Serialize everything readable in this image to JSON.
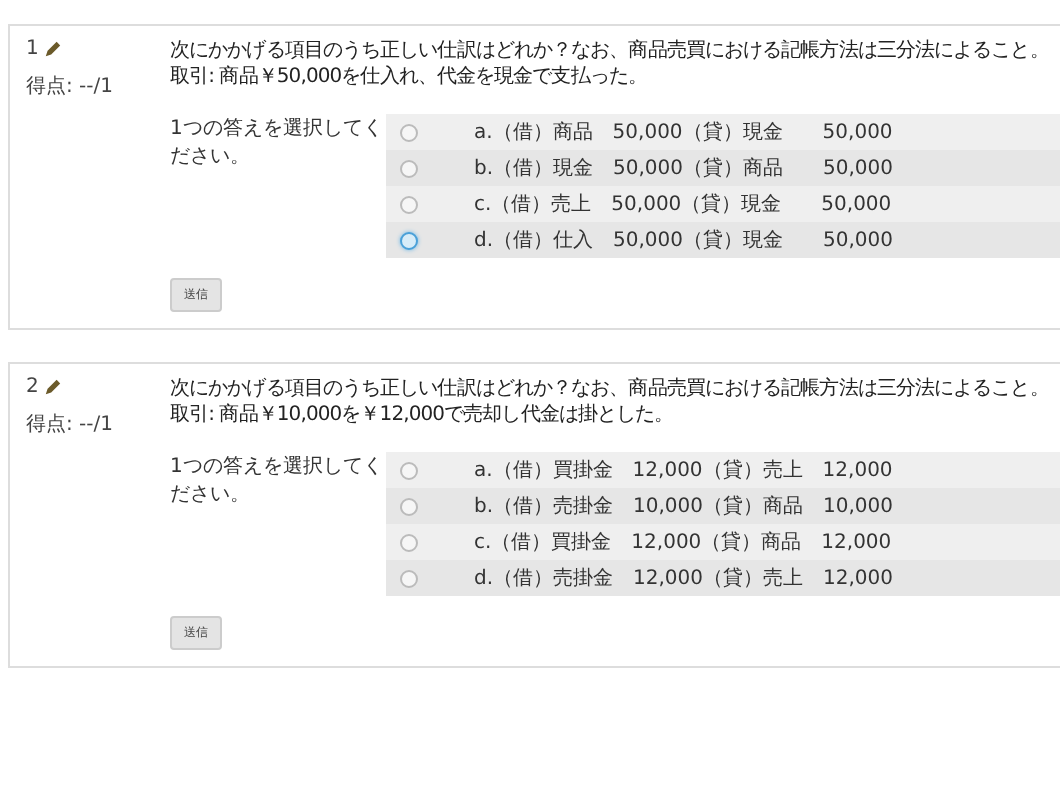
{
  "questions": [
    {
      "number": "1",
      "score": "得点: --/1",
      "text": "次にかかげる項目のうち正しい仕訳はどれか？なお、商品売買における記帳方法は三分法によること。",
      "detail": "取引: 商品￥50,000を仕入れ、代金を現金で支払った。",
      "prompt": "1つの答えを選択してください。",
      "options": [
        {
          "label": "a.（借）商品　50,000（貸）現金　　50,000",
          "focused": false
        },
        {
          "label": "b.（借）現金　50,000（貸）商品　　50,000",
          "focused": false
        },
        {
          "label": "c.（借）売上　50,000（貸）現金　　50,000",
          "focused": false
        },
        {
          "label": "d.（借）仕入　50,000（貸）現金　　50,000",
          "focused": true
        }
      ],
      "submit": "送信"
    },
    {
      "number": "2",
      "score": "得点: --/1",
      "text": "次にかかげる項目のうち正しい仕訳はどれか？なお、商品売買における記帳方法は三分法によること。",
      "detail": "取引: 商品￥10,000を￥12,000で売却し代金は掛とした。",
      "prompt": "1つの答えを選択してください。",
      "options": [
        {
          "label": "a.（借）買掛金　12,000（貸）売上　12,000",
          "focused": false
        },
        {
          "label": "b.（借）売掛金　10,000（貸）商品　10,000",
          "focused": false
        },
        {
          "label": "c.（借）買掛金　12,000（貸）商品　12,000",
          "focused": false
        },
        {
          "label": "d.（借）売掛金　12,000（貸）売上　12,000",
          "focused": false
        }
      ],
      "submit": "送信"
    }
  ]
}
